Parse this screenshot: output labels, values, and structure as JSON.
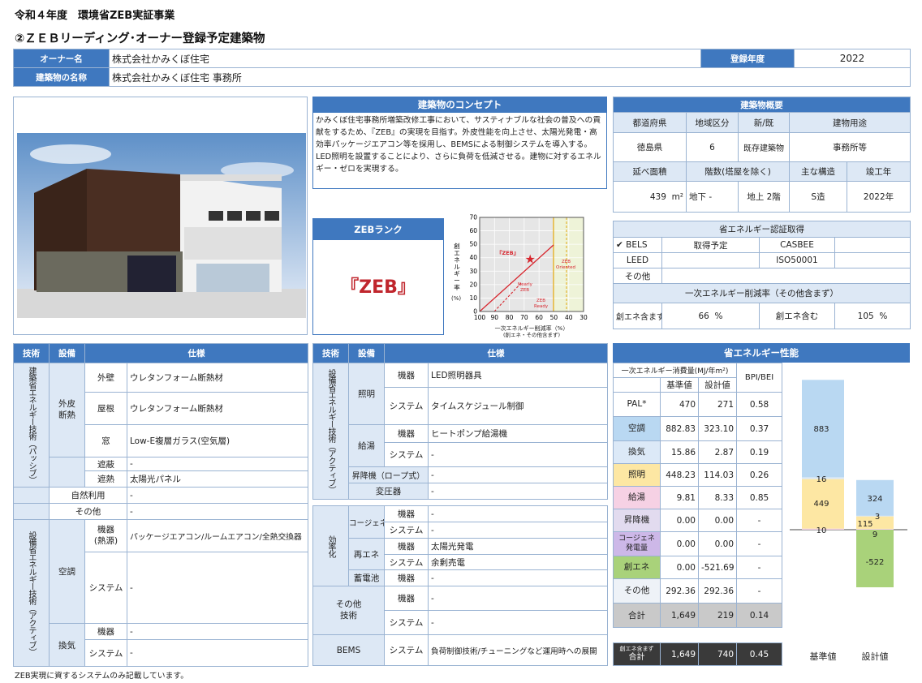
{
  "header": {
    "line1": "令和４年度　環境省ZEB実証事業",
    "line2": "②ＺＥＢリーディング･オーナー登録予定建築物"
  },
  "owner": {
    "owner_label": "オーナー名",
    "owner_value": "株式会社かみくぼ住宅",
    "year_label": "登録年度",
    "year_value": "2022",
    "building_label": "建築物の名称",
    "building_value": "株式会社かみくぼ住宅 事務所"
  },
  "concept": {
    "title": "建築物のコンセプト",
    "text": "かみくぼ住宅事務所増築改修工事において、サスティナブルな社会の普及への貢献をするため、『ZEB』の実現を目指す。外皮性能を向上させ、太陽光発電・高効率パッケージエアコン等を採用し、BEMSによる制御システムを導入する。LED照明を設置することにより、さらに負荷を低減させる。建物に対するエネルギー・ゼロを実現する。"
  },
  "zeb_rank": {
    "title": "ZEBランク",
    "value": "『ZEB』"
  },
  "zeb_chart": {
    "ylabel_chars": [
      "創",
      "エ",
      "ネ",
      "ル",
      "ギ",
      "ー",
      "率"
    ],
    "ylabel_unit": "(%)",
    "xlabel1": "一次エネルギー削減率（%）",
    "xlabel2": "(創エネ・その他含まず)",
    "yticks": [
      "70",
      "60",
      "50",
      "40",
      "30",
      "20",
      "10",
      "0"
    ],
    "xticks": [
      "100",
      "90",
      "80",
      "70",
      "60",
      "50",
      "40",
      "30"
    ],
    "label_zeb": "『ZEB』",
    "label_nearly1": "Nearly",
    "label_nearly2": "ZEB",
    "label_ready1": "ZEB",
    "label_ready2": "Ready",
    "label_oriented1": "ZEB",
    "label_oriented2": "Oriented",
    "point": {
      "reduction": 66,
      "creation": 39
    }
  },
  "overview": {
    "title": "建築物概要",
    "h_pref": "都道府県",
    "h_region": "地域区分",
    "h_newold": "新/既",
    "h_use": "建物用途",
    "pref": "徳島県",
    "region": "6",
    "newold": "既存建築物",
    "use": "事務所等",
    "h_area": "延べ面積",
    "h_floors": "階数(塔屋を除く)",
    "h_struct": "主な構造",
    "h_year": "竣工年",
    "area": "439",
    "area_unit": "m²",
    "floors_below": "地下 -",
    "floors_above": "地上 2階",
    "struct": "S造",
    "year": "2022年",
    "cert_title": "省エネルギー認証取得",
    "check": "✔",
    "bels": "BELS",
    "bels_status": "取得予定",
    "casbee": "CASBEE",
    "casbee_status": "",
    "leed": "LEED",
    "leed_status": "",
    "iso": "ISO50001",
    "iso_status": "",
    "other": "その他",
    "other_status": "",
    "red_title": "一次エネルギー削減率（その他含まず）",
    "excl_label": "創エネ含まず",
    "excl_value": "66",
    "incl_label": "創エネ含む",
    "incl_value": "105",
    "pct": "%"
  },
  "tech_left": {
    "h_tech": "技術",
    "h_equip": "設備",
    "h_spec": "仕様",
    "passive": "建築省エネルギー技術（パッシブ）",
    "envelope": "外皮\n断熱",
    "wall": "外壁",
    "wall_v": "ウレタンフォーム断熱材",
    "roof": "屋根",
    "roof_v": "ウレタンフォーム断熱材",
    "window": "窓",
    "window_v": "Low-E複層ガラス(空気層)",
    "shade1": "遮蔽",
    "shade1_v": "-",
    "shade2": "遮熱",
    "shade2_v": "太陽光パネル",
    "natural": "自然利用",
    "natural_v": "-",
    "others": "その他",
    "others_v": "-",
    "active": "設備省エネルギー技術（アクティブ）",
    "ac": "空調",
    "ac_eq": "機器\n(熱源)",
    "ac_eq_v": "パッケージエアコン/ルームエアコン/全熱交換器",
    "ac_sys": "システム",
    "ac_sys_v": "-",
    "vent": "換気",
    "vent_eq": "機器",
    "vent_eq_v": "-",
    "vent_sys": "システム",
    "vent_sys_v": "-"
  },
  "tech_mid": {
    "h_tech": "技術",
    "h_equip": "設備",
    "h_spec": "仕様",
    "active": "設備省エネルギー技術（アクティブ）",
    "light": "照明",
    "light_eq": "機器",
    "light_eq_v": "LED照明器具",
    "light_sys": "システム",
    "light_sys_v": "タイムスケジュール制御",
    "hw": "給湯",
    "hw_eq": "機器",
    "hw_eq_v": "ヒートポンプ給湯機",
    "hw_sys": "システム",
    "hw_sys_v": "-",
    "elev": "昇降機（ロープ式）",
    "elev_v": "-",
    "trans": "変圧器",
    "trans_v": "-",
    "eff": "効率化",
    "cogen": "コージェネ",
    "cogen_eq": "機器",
    "cogen_eq_v": "-",
    "cogen_sys": "システム",
    "cogen_sys_v": "-",
    "renew": "再エネ",
    "renew_eq": "機器",
    "renew_eq_v": "太陽光発電",
    "renew_sys": "システム",
    "renew_sys_v": "余剰売電",
    "battery": "蓄電池",
    "battery_eq": "機器",
    "battery_eq_v": "-",
    "other": "その他\n技術",
    "other_eq": "機器",
    "other_eq_v": "-",
    "other_sys": "システム",
    "other_sys_v": "-",
    "bems": "BEMS",
    "bems_sys": "システム",
    "bems_sys_v": "負荷制御技術/チューニングなど運用時への展開"
  },
  "perf": {
    "title": "省エネルギー性能",
    "h_consumption": "一次エネルギー消費量(MJ/年m²)",
    "h_base": "基準値",
    "h_design": "設計値",
    "h_bpi": "BPI/BEI",
    "rows": [
      {
        "label": "PAL*",
        "base": "470",
        "design": "271",
        "ratio": "0.58",
        "cls": ""
      },
      {
        "label": "空調",
        "base": "882.83",
        "design": "323.10",
        "ratio": "0.37",
        "cls": "c-kucho"
      },
      {
        "label": "換気",
        "base": "15.86",
        "design": "2.87",
        "ratio": "0.19",
        "cls": "c-kanki"
      },
      {
        "label": "照明",
        "base": "448.23",
        "design": "114.03",
        "ratio": "0.26",
        "cls": "c-shomei"
      },
      {
        "label": "給湯",
        "base": "9.81",
        "design": "8.33",
        "ratio": "0.85",
        "cls": "c-kyuto"
      },
      {
        "label": "昇降機",
        "base": "0.00",
        "design": "0.00",
        "ratio": "-",
        "cls": "c-shokoki"
      },
      {
        "label": "コージェネ\n発電量",
        "base": "0.00",
        "design": "0.00",
        "ratio": "-",
        "cls": "c-cogen"
      },
      {
        "label": "創エネ",
        "base": "0.00",
        "design": "-521.69",
        "ratio": "-",
        "cls": "c-soene"
      },
      {
        "label": "その他",
        "base": "292.36",
        "design": "292.36",
        "ratio": "-",
        "cls": "c-other"
      }
    ],
    "total_label": "合計",
    "total_base": "1,649",
    "total_design": "219",
    "total_ratio": "0.14",
    "total2_label1": "創エネ含まず",
    "total2_label2": "合計",
    "total2_base": "1,649",
    "total2_design": "740",
    "total2_ratio": "0.45"
  },
  "chart_data": {
    "type": "bar",
    "categories": [
      "基準値",
      "設計値"
    ],
    "series": [
      {
        "label_text": "10",
        "values": [
          10,
          8
        ],
        "color": "#f6d1e4"
      },
      {
        "label_text": "449",
        "values": [
          449,
          115
        ],
        "color": "#fde7a3"
      },
      {
        "label_text": "16",
        "values": [
          16,
          3
        ],
        "color": "#dce9f7"
      },
      {
        "label_text": "883",
        "values": [
          883,
          324
        ],
        "color": "#b9d8f2"
      },
      {
        "label_text": "-522",
        "values": [
          0,
          -522
        ],
        "color": "#a9d27a"
      }
    ],
    "bar_labels": {
      "base": [
        "10",
        "449",
        "16",
        "883"
      ],
      "design": [
        "9",
        "115",
        "3",
        "324",
        "-522"
      ]
    }
  },
  "footer": {
    "note": "ZEB実現に資するシステムのみ記載しています。"
  }
}
